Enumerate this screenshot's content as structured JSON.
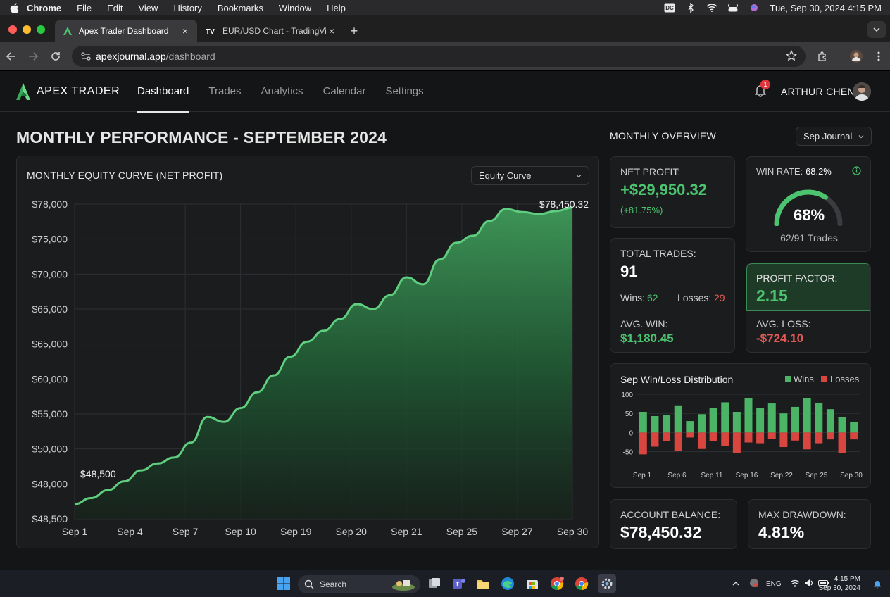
{
  "menubar": {
    "app": "Chrome",
    "items": [
      "File",
      "Edit",
      "View",
      "History",
      "Bookmarks",
      "Window",
      "Help"
    ],
    "datetime": "Tue, Sep 30, 2024  4:15 PM"
  },
  "tabs": [
    {
      "title": "Apex Trader Dashboard"
    },
    {
      "title": "EUR/USD Chart - TradingView"
    }
  ],
  "address": {
    "host": "apexjournal.app",
    "path": "/dashboard"
  },
  "nav": {
    "brand": "APEX TRADER",
    "links": [
      "Dashboard",
      "Trades",
      "Analytics",
      "Calendar",
      "Settings"
    ],
    "notif_count": "1",
    "user": "ARTHUR CHEN"
  },
  "page_title": "MONTHLY PERFORMANCE - SEPTEMBER 2024",
  "equity": {
    "title": "MONTHLY EQUITY CURVE (NET PROFIT)",
    "select": "Equity Curve",
    "start_label": "$48,500",
    "end_label": "$78,450.32",
    "y_ticks": [
      "$78,000",
      "$75,000",
      "$70,000",
      "$65,000",
      "$65,000",
      "$60,000",
      "$55,000",
      "$50,000",
      "$48,000",
      "$48,500"
    ],
    "x_ticks": [
      "Sep 1",
      "Sep 4",
      "Sep 7",
      "Sep 10",
      "Sep 19",
      "Sep 20",
      "Sep 21",
      "Sep 25",
      "Sep 27",
      "Sep 30"
    ]
  },
  "overview": {
    "title": "MONTHLY OVERVIEW",
    "select": "Sep Journal",
    "net_profit_label": "NET PROFIT:",
    "net_profit": "+$29,950.32",
    "net_profit_pct": "(+81.75%)",
    "win_rate_label": "WIN RATE:",
    "win_rate": "68.2%",
    "win_rate_gauge": "68%",
    "win_rate_trades": "62/91 Trades",
    "total_trades_label": "TOTAL TRADES:",
    "total_trades": "91",
    "wins_label": "Wins:",
    "wins": "62",
    "losses_label": "Losses:",
    "losses": "29",
    "avg_win_label": "AVG. WIN:",
    "avg_win": "$1,180.45",
    "profit_factor_label": "PROFIT FACTOR:",
    "profit_factor": "2.15",
    "avg_loss_label": "AVG. LOSS:",
    "avg_loss": "-$724.10",
    "account_balance_label": "ACCOUNT BALANCE:",
    "account_balance": "$78,450.32",
    "max_drawdown_label": "MAX DRAWDOWN:",
    "max_drawdown": "4.81%"
  },
  "distribution": {
    "title": "Sep Win/Loss Distribution",
    "legend_wins": "Wins",
    "legend_losses": "Losses",
    "y_ticks": [
      "100",
      "50",
      "0",
      "-50"
    ],
    "x_ticks": [
      "Sep 1",
      "Sep 6",
      "Sep 11",
      "Sep 16",
      "Sep 22",
      "Sep 25",
      "Sep 30"
    ]
  },
  "chart_data": [
    {
      "type": "area",
      "title": "MONTHLY EQUITY CURVE (NET PROFIT)",
      "x": [
        0,
        1,
        2,
        3,
        4,
        5,
        6,
        7,
        8,
        9,
        10,
        11,
        12,
        13,
        14,
        15,
        16,
        17,
        18,
        19,
        20,
        21,
        22,
        23,
        24,
        25,
        26,
        27,
        28,
        29,
        30
      ],
      "values": [
        48500,
        49100,
        49900,
        50800,
        51900,
        52600,
        53200,
        54700,
        57300,
        56800,
        58200,
        59800,
        61500,
        63400,
        64900,
        66000,
        67200,
        68700,
        68200,
        69600,
        71400,
        70700,
        73200,
        74900,
        75600,
        77100,
        78300,
        78000,
        77800,
        78100,
        78450.32
      ],
      "color": "#4cc36f"
    },
    {
      "type": "bar",
      "title": "Sep Win/Loss Distribution",
      "series": [
        {
          "name": "Wins",
          "color": "#4cb467",
          "values": [
            54,
            43,
            45,
            71,
            30,
            48,
            64,
            79,
            54,
            90,
            64,
            76,
            50,
            67,
            90,
            78,
            61,
            40,
            28
          ]
        },
        {
          "name": "Losses",
          "color": "#d9463f",
          "values": [
            -57,
            -37,
            -22,
            -48,
            -13,
            -43,
            -23,
            -36,
            -53,
            -26,
            -28,
            -17,
            -38,
            -21,
            -44,
            -28,
            -18,
            -53,
            -18
          ]
        }
      ],
      "ylim": [
        -60,
        100
      ]
    }
  ],
  "taskbar": {
    "search": "Search",
    "lang": "ENG",
    "time": "4:15 PM",
    "date": "Sep 30, 2024"
  }
}
